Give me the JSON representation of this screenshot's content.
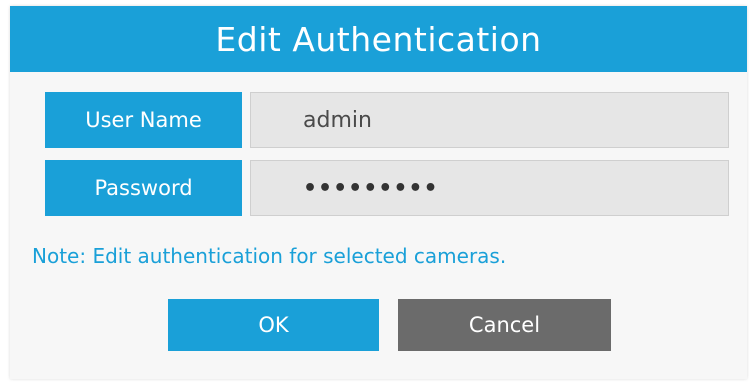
{
  "dialog": {
    "title": "Edit Authentication",
    "username_label": "User Name",
    "username_value": "admin",
    "password_label": "Password",
    "password_value": "•••••••••",
    "note": "Note: Edit authentication for selected cameras.",
    "ok_label": "OK",
    "cancel_label": "Cancel"
  },
  "colors": {
    "accent": "#1aa0d8",
    "field_bg": "#e6e6e6",
    "cancel_bg": "#6b6b6b"
  }
}
